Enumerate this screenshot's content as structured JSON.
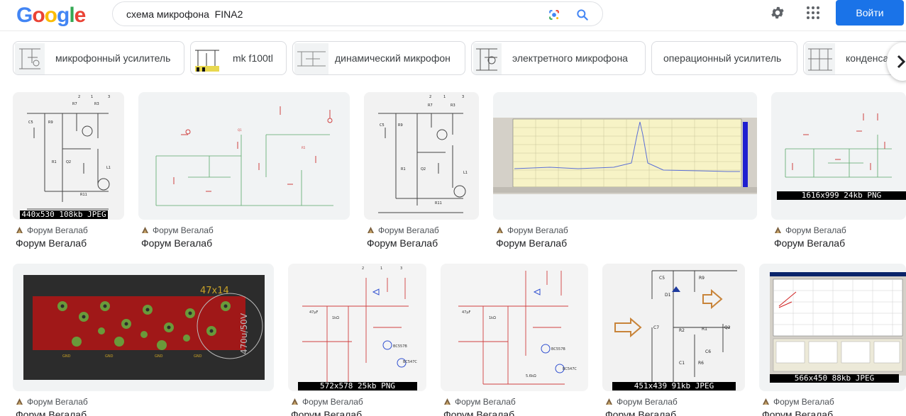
{
  "header": {
    "logo": [
      "G",
      "o",
      "o",
      "g",
      "l",
      "e"
    ],
    "logo_colors": [
      "#4285f4",
      "#ea4335",
      "#fbbc05",
      "#4285f4",
      "#34a853",
      "#ea4335"
    ],
    "query": "схема микрофона  FINA2",
    "signin_label": "Войти"
  },
  "chips": [
    {
      "label": "микрофонный усилитель",
      "thumb": true
    },
    {
      "label": "mk f100tl",
      "thumb": true
    },
    {
      "label": "динамический микрофон",
      "thumb": true
    },
    {
      "label": "электретного микрофона",
      "thumb": true
    },
    {
      "label": "операционный усилитель",
      "thumb": false
    },
    {
      "label": "конденса",
      "thumb": true
    }
  ],
  "results": [
    {
      "source": "Форум Вегалаб",
      "title": "Форум Вегалаб",
      "dims": "440x530  108kb  JPEG",
      "kind": "schematic-bw"
    },
    {
      "source": "Форум Вегалаб",
      "title": "Форум Вегалаб",
      "dims": "",
      "kind": "schematic-red"
    },
    {
      "source": "Форум Вегалаб",
      "title": "Форум Вегалаб",
      "dims": "",
      "kind": "schematic-bw"
    },
    {
      "source": "Форум Вегалаб",
      "title": "Форум Вегалаб",
      "dims": "",
      "kind": "spectrum"
    },
    {
      "source": "Форум Вегалаб",
      "title": "Форум Вегалаб",
      "dims": "1616x999  24kb  PNG",
      "kind": "schematic-red"
    },
    {
      "source": "Форум Вегалаб",
      "title": "Форум Вегалаб",
      "dims": "",
      "kind": "pcb",
      "pcb_text": "47x14",
      "pcb_side": "470u/50V"
    },
    {
      "source": "Форум Вегалаб",
      "title": "Форум Вегалаб",
      "dims": "572x578  25kb  PNG",
      "kind": "schematic-color"
    },
    {
      "source": "Форум Вегалаб",
      "title": "Форум Вегалаб",
      "dims": "",
      "kind": "schematic-color"
    },
    {
      "source": "Форум Вегалаб",
      "title": "Форум Вегалаб",
      "dims": "451x439  91kb  JPEG",
      "kind": "schematic-arrows"
    },
    {
      "source": "Форум Вегалаб",
      "title": "Форум Вегалаб",
      "dims": "566x450  88kb  JPEG",
      "kind": "oscilloscope"
    }
  ]
}
